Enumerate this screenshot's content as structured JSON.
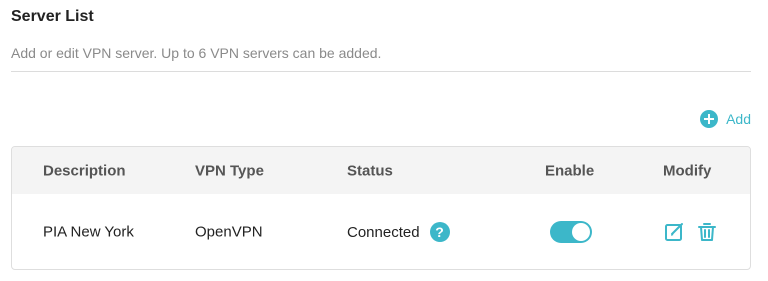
{
  "section": {
    "title": "Server List",
    "description": "Add or edit VPN server. Up to 6 VPN servers can be added."
  },
  "toolbar": {
    "add_label": "Add"
  },
  "table": {
    "headers": {
      "description": "Description",
      "vpn_type": "VPN Type",
      "status": "Status",
      "enable": "Enable",
      "modify": "Modify"
    },
    "rows": [
      {
        "description": "PIA New York",
        "vpn_type": "OpenVPN",
        "status": "Connected",
        "help_symbol": "?",
        "enabled": true
      }
    ]
  },
  "colors": {
    "accent": "#3cb7c9"
  },
  "icons": {
    "add": "plus-circle-icon",
    "help": "question-circle-icon",
    "edit": "edit-icon",
    "delete": "trash-icon"
  }
}
